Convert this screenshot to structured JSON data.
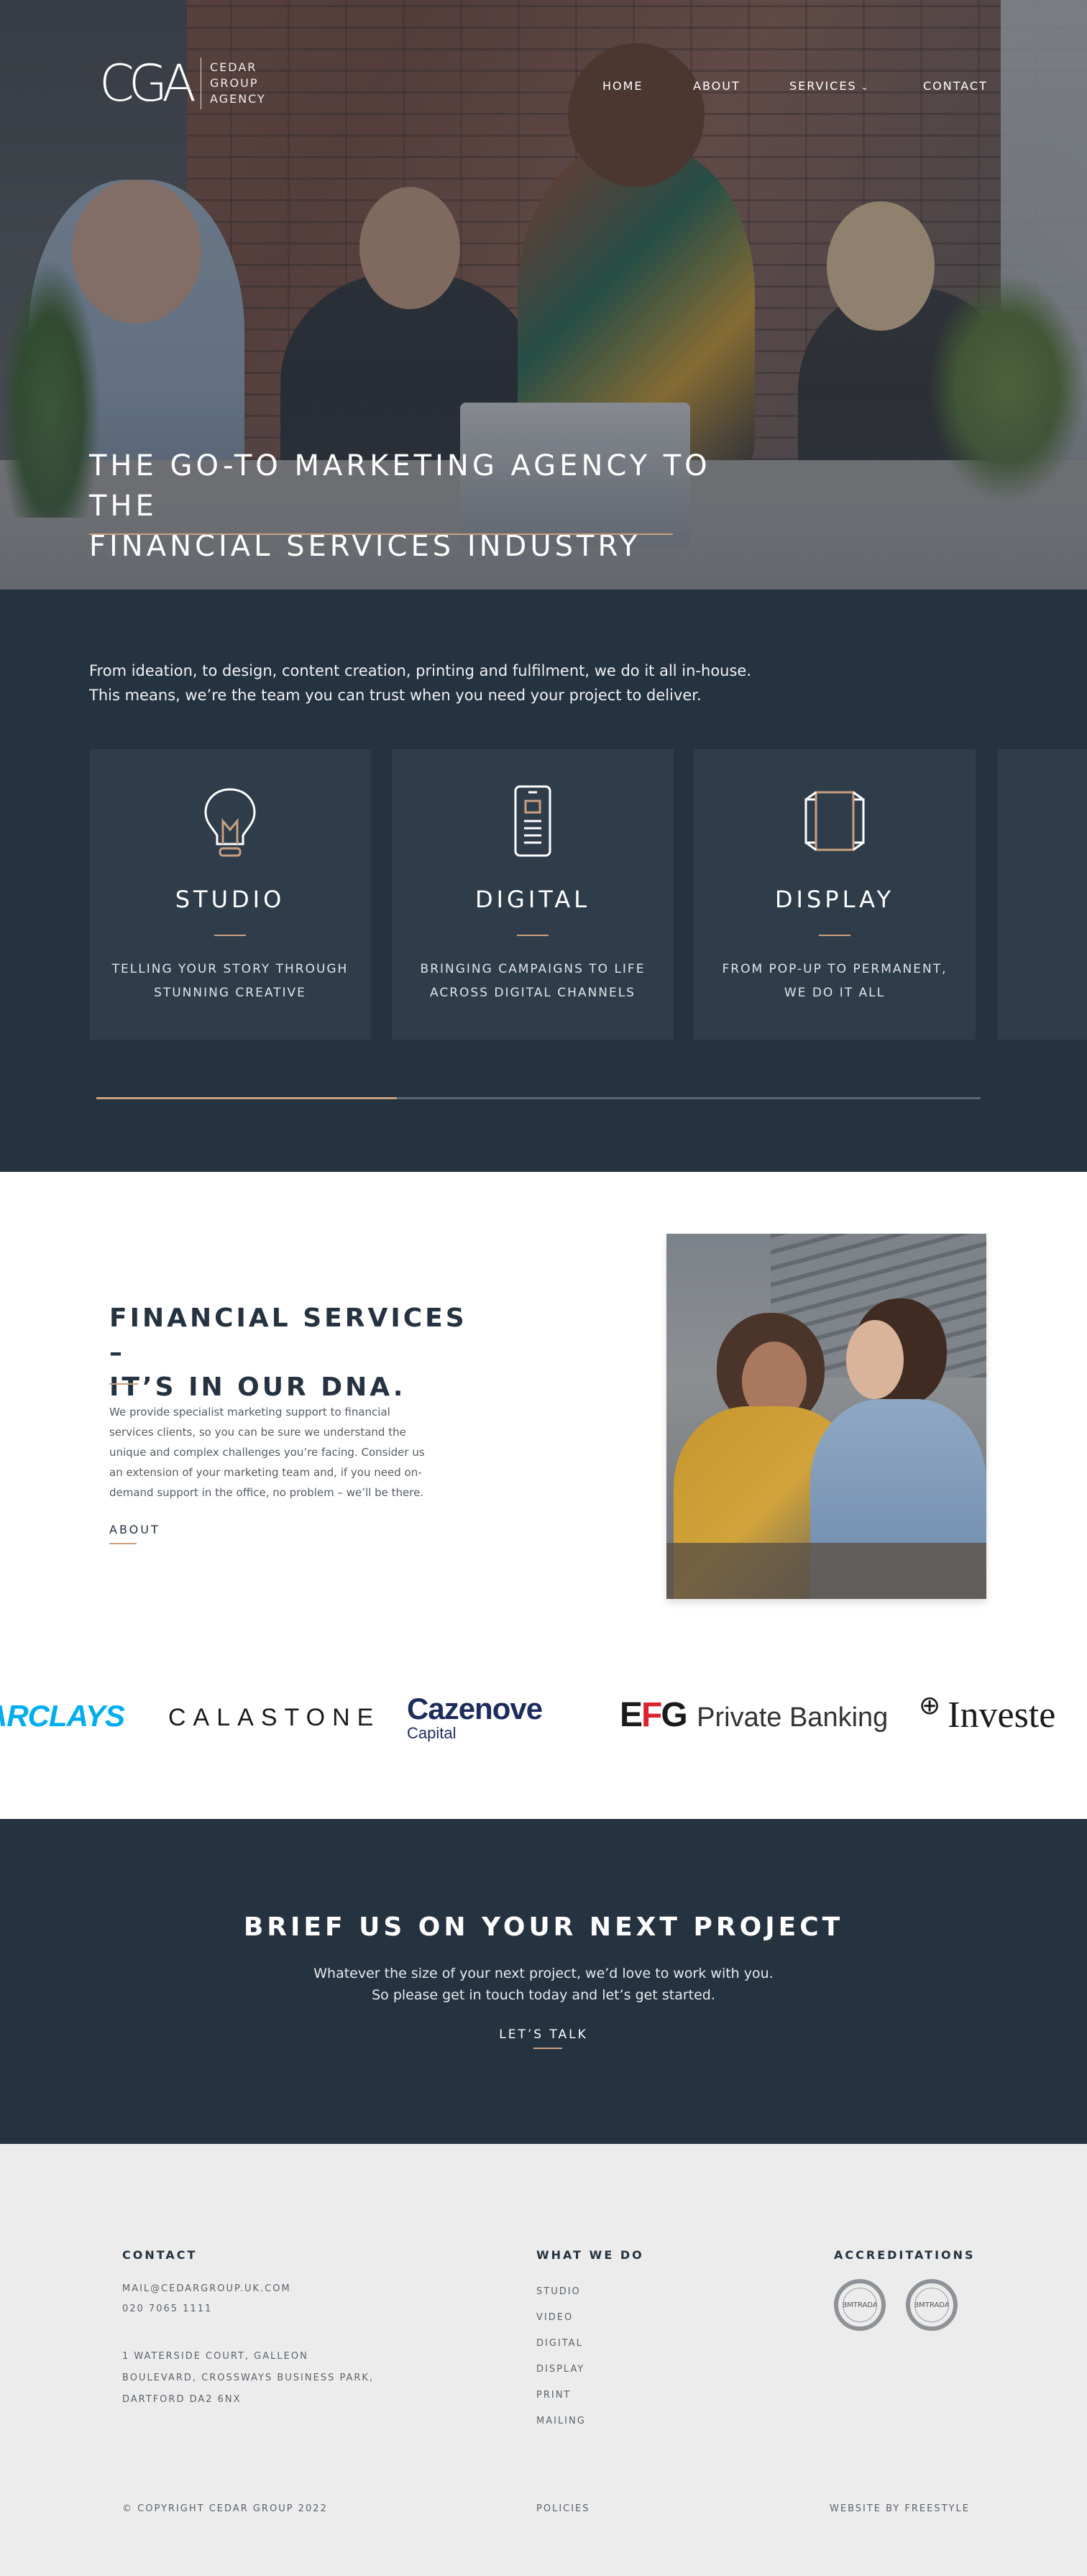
{
  "brand": {
    "logo_mark": "CGA",
    "logo_lines": [
      "CEDAR",
      "GROUP",
      "AGENCY"
    ]
  },
  "nav": {
    "home": "HOME",
    "about": "ABOUT",
    "services": "SERVICES",
    "contact": "CONTACT"
  },
  "hero": {
    "title_line1": "THE GO-TO MARKETING AGENCY TO THE",
    "title_line2": "FINANCIAL SERVICES INDUSTRY"
  },
  "services": {
    "intro_line1": "From ideation, to design, content creation, printing and fulfilment, we do it all in-house.",
    "intro_line2": "This means, we’re the team you can trust when you need your project to deliver.",
    "cards": [
      {
        "icon": "lightbulb-icon",
        "title": "STUDIO",
        "desc_line1": "TELLING YOUR STORY THROUGH",
        "desc_line2": "STUNNING CREATIVE"
      },
      {
        "icon": "mobile-phone-icon",
        "title": "DIGITAL",
        "desc_line1": "BRINGING CAMPAIGNS TO LIFE",
        "desc_line2": "ACROSS DIGITAL CHANNELS"
      },
      {
        "icon": "display-stand-icon",
        "title": "DISPLAY",
        "desc_line1": "FROM POP-UP TO PERMANENT,",
        "desc_line2": "WE DO IT ALL"
      }
    ],
    "carousel_progress": 0.34,
    "accent_color": "#c9a07f",
    "background_color": "#253240"
  },
  "financial": {
    "title_line1": "FINANCIAL SERVICES –",
    "title_line2": "IT’S IN OUR DNA.",
    "text": "We provide specialist marketing support to financial services clients, so you can be sure we understand the unique and complex challenges you’re facing. Consider us an extension of your marketing team and, if you need on-demand support in the office, no problem – we’ll be there.",
    "link": "ABOUT"
  },
  "clients": {
    "barclays": "ARCLAYS",
    "calastone": "CALASTONE",
    "cazenove_name": "Cazenove",
    "cazenove_sub": "Capital",
    "efg_mark_e": "E",
    "efg_mark_f": "F",
    "efg_mark_g": "G",
    "efg_text": "Private Banking",
    "investec": "Investe"
  },
  "cta": {
    "title": "BRIEF US ON YOUR NEXT PROJECT",
    "text_line1": "Whatever the size of your next project, we’d love to work with you.",
    "text_line2": "So please get in touch today and let’s get started.",
    "link": "LET’S TALK"
  },
  "footer": {
    "contact_heading": "CONTACT",
    "email": "MAIL@CEDARGROUP.UK.COM",
    "phone": "020 7065 1111",
    "address_line1": "1 WATERSIDE COURT, GALLEON",
    "address_line2": "BOULEVARD, CROSSWAYS BUSINESS PARK,",
    "address_line3": "DARTFORD DA2 6NX",
    "what_heading": "WHAT WE DO",
    "what_items": [
      "STUDIO",
      "VIDEO",
      "DIGITAL",
      "DISPLAY",
      "PRINT",
      "MAILING"
    ],
    "accred_heading": "ACCREDITATIONS",
    "badge1": "BMTRADA",
    "badge2": "BMTRADA",
    "copyright": "© COPYRIGHT CEDAR GROUP 2022",
    "policies": "POLICIES",
    "credit": "WEBSITE BY FREESTYLE"
  }
}
